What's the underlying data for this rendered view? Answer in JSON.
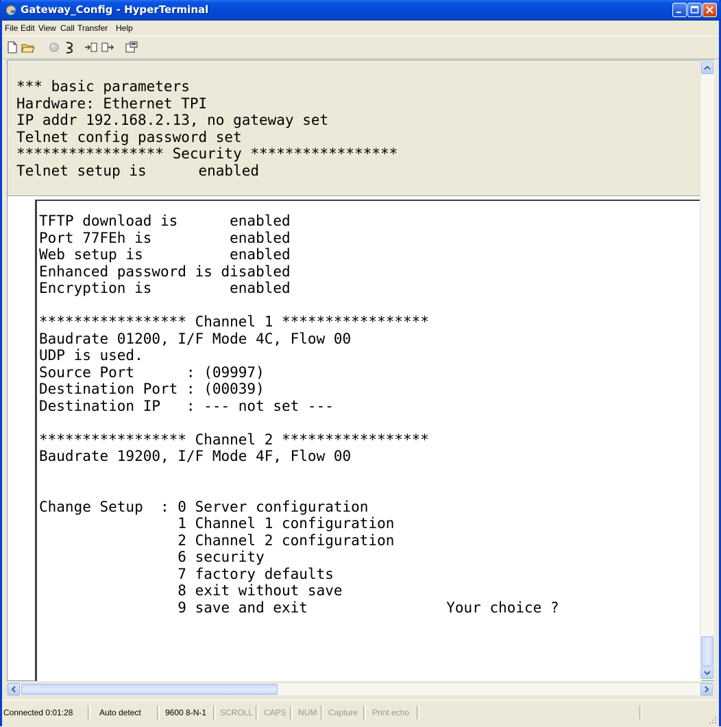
{
  "window": {
    "title": "Gateway_Config - HyperTerminal",
    "titlebar_color": "#0549d8"
  },
  "menu": {
    "items": [
      "File",
      "Edit",
      "View",
      "Call",
      "Transfer",
      "Help"
    ]
  },
  "toolbar": {
    "icons": [
      "new-connection-icon",
      "open-icon",
      "disconnect-icon",
      "dial-icon",
      "send-file-icon",
      "receive-file-icon",
      "properties-icon"
    ]
  },
  "terminal": {
    "scrollback_lines": [
      "*** basic parameters",
      "Hardware: Ethernet TPI",
      "IP addr 192.168.2.13, no gateway set",
      "Telnet config password set",
      "***************** Security *****************",
      "Telnet setup is      enabled"
    ],
    "live_lines": [
      "TFTP download is      enabled",
      "Port 77FEh is         enabled",
      "Web setup is          enabled",
      "Enhanced password is disabled",
      "Encryption is         enabled",
      "",
      "***************** Channel 1 *****************",
      "Baudrate 01200, I/F Mode 4C, Flow 00",
      "UDP is used.",
      "Source Port      : (09997)",
      "Destination Port : (00039)",
      "Destination IP   : --- not set ---",
      "",
      "***************** Channel 2 *****************",
      "Baudrate 19200, I/F Mode 4F, Flow 00",
      "",
      "",
      "Change Setup  : 0 Server configuration",
      "                1 Channel 1 configuration",
      "                2 Channel 2 configuration",
      "                6 security",
      "                7 factory defaults",
      "                8 exit without save",
      "                9 save and exit                Your choice ?"
    ]
  },
  "statusbar": {
    "connected": "Connected 0:01:28",
    "detect": "Auto detect",
    "port_settings": "9600 8-N-1",
    "scroll": "SCROLL",
    "caps": "CAPS",
    "num": "NUM",
    "capture": "Capture",
    "print_echo": "Print echo"
  }
}
